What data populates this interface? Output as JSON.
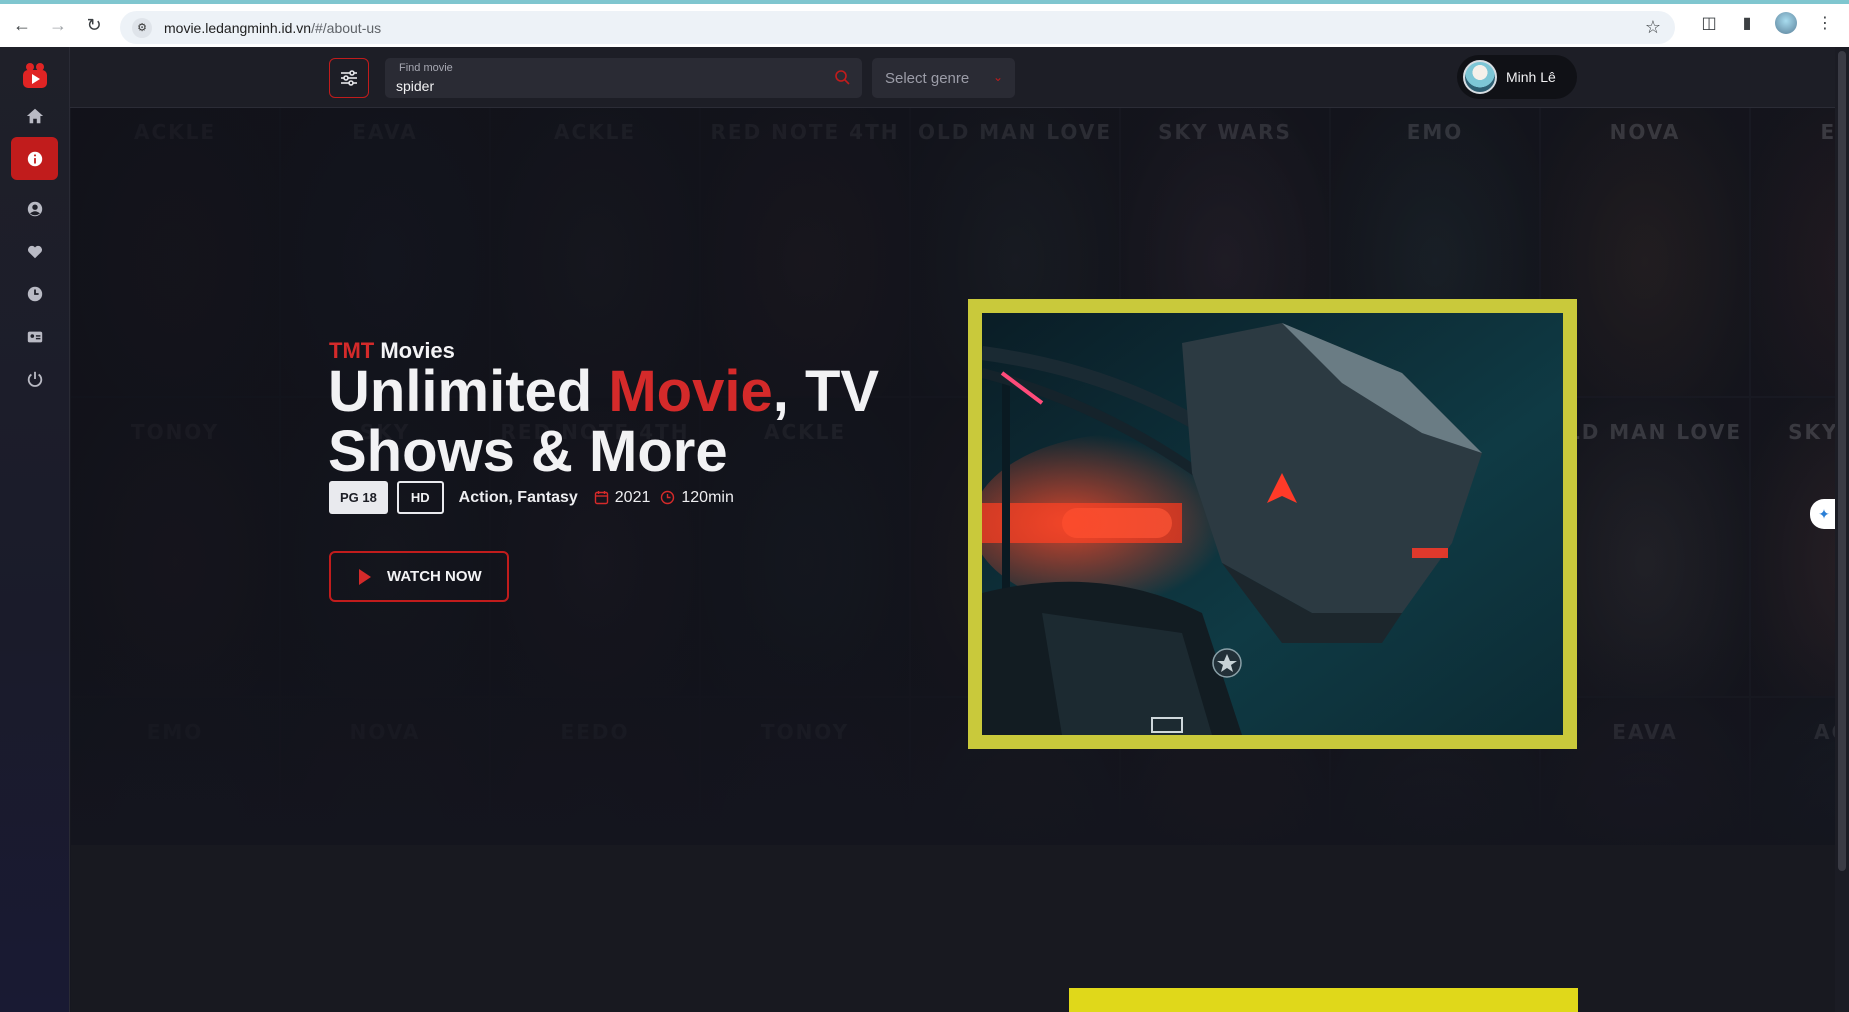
{
  "browser": {
    "url_host": "movie.ledangminh.id.vn",
    "url_path": "/#/about-us"
  },
  "sidebar": {
    "items": [
      {
        "name": "home"
      },
      {
        "name": "about",
        "active": true
      },
      {
        "name": "profile"
      },
      {
        "name": "favorites"
      },
      {
        "name": "history"
      },
      {
        "name": "contact"
      },
      {
        "name": "logout"
      }
    ]
  },
  "search": {
    "label": "Find movie",
    "value": "spider",
    "genre_placeholder": "Select genre"
  },
  "user": {
    "name": "Minh Lê"
  },
  "hero": {
    "brand_accent": "TMT",
    "brand_rest": " Movies",
    "headline_1": "Unlimited ",
    "headline_accent": "Movie",
    "headline_2": ", TV Shows & More",
    "rating_badge": "PG 18",
    "quality_badge": "HD",
    "genres": "Action,  Fantasy",
    "year": "2021",
    "duration": "120min",
    "cta": "WATCH NOW"
  },
  "posters": [
    "ACKLE",
    "EAVA",
    "ACKLE",
    "RED NOTE 4TH",
    "OLD MAN LOVE",
    "SKY WARS",
    "EMO",
    "NOVA",
    "EEDO",
    "TONOY",
    "SKY",
    "RED NOTE 4TH"
  ],
  "colors": {
    "accent": "#c11c1c",
    "frame": "#c9c93b",
    "bottom_bar": "#e0d81a"
  }
}
